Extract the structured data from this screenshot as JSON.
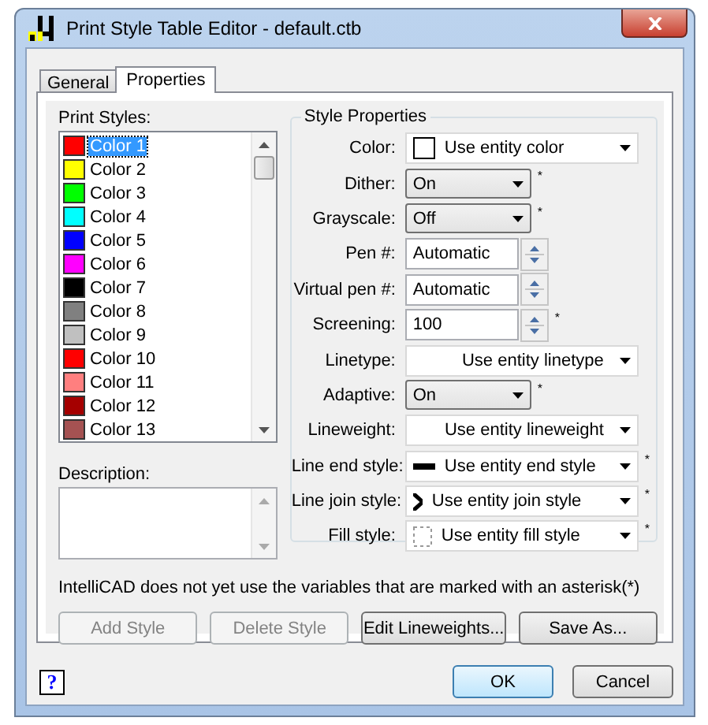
{
  "window": {
    "title": "Print Style Table Editor - default.ctb"
  },
  "tabs": [
    {
      "label": "General",
      "selected": false
    },
    {
      "label": "Properties",
      "selected": true
    }
  ],
  "print_styles": {
    "label": "Print Styles:",
    "items": [
      {
        "name": "Color 1",
        "color": "#ff0000",
        "selected": true
      },
      {
        "name": "Color 2",
        "color": "#ffff00",
        "selected": false
      },
      {
        "name": "Color 3",
        "color": "#00ff00",
        "selected": false
      },
      {
        "name": "Color 4",
        "color": "#00ffff",
        "selected": false
      },
      {
        "name": "Color 5",
        "color": "#0000ff",
        "selected": false
      },
      {
        "name": "Color 6",
        "color": "#ff00ff",
        "selected": false
      },
      {
        "name": "Color 7",
        "color": "#000000",
        "selected": false
      },
      {
        "name": "Color 8",
        "color": "#808080",
        "selected": false
      },
      {
        "name": "Color 9",
        "color": "#c0c0c0",
        "selected": false
      },
      {
        "name": "Color 10",
        "color": "#ff0000",
        "selected": false
      },
      {
        "name": "Color 11",
        "color": "#ff7f7f",
        "selected": false
      },
      {
        "name": "Color 12",
        "color": "#a50000",
        "selected": false
      },
      {
        "name": "Color 13",
        "color": "#a55252",
        "selected": false
      }
    ]
  },
  "description": {
    "label": "Description:"
  },
  "style_properties": {
    "title": "Style Properties",
    "rows": [
      {
        "label": "Color:",
        "kind": "color",
        "value": "Use entity color"
      },
      {
        "label": "Dither:",
        "kind": "combo",
        "value": "On",
        "note": "*"
      },
      {
        "label": "Grayscale:",
        "kind": "combo",
        "value": "Off",
        "note": "*"
      },
      {
        "label": "Pen #:",
        "kind": "spin",
        "value": "Automatic"
      },
      {
        "label": "Virtual pen #:",
        "kind": "spin",
        "value": "Automatic"
      },
      {
        "label": "Screening:",
        "kind": "spin",
        "value": "100",
        "note": "*"
      },
      {
        "label": "Linetype:",
        "kind": "dropdown",
        "value": "Use entity linetype"
      },
      {
        "label": "Adaptive:",
        "kind": "combo",
        "value": "On",
        "note": "*"
      },
      {
        "label": "Lineweight:",
        "kind": "dropdown",
        "value": "Use entity lineweight"
      },
      {
        "label": "Line end style:",
        "kind": "end_style",
        "value": "Use entity end style",
        "note": "*"
      },
      {
        "label": "Line join style:",
        "kind": "join_style",
        "value": "Use entity join style",
        "note": "*"
      },
      {
        "label": "Fill style:",
        "kind": "fill_style",
        "value": "Use entity fill style",
        "note": "*"
      }
    ]
  },
  "note": "IntelliCAD does not yet use the variables that are marked with an asterisk(*)",
  "actions": [
    {
      "label": "Add Style",
      "disabled": true
    },
    {
      "label": "Delete Style",
      "disabled": true
    },
    {
      "label": "Edit Lineweights...",
      "disabled": false
    },
    {
      "label": "Save As...",
      "disabled": false
    }
  ],
  "footer": {
    "help": "?",
    "buttons": [
      {
        "label": "OK",
        "default": true
      },
      {
        "label": "Cancel",
        "default": false
      }
    ]
  }
}
